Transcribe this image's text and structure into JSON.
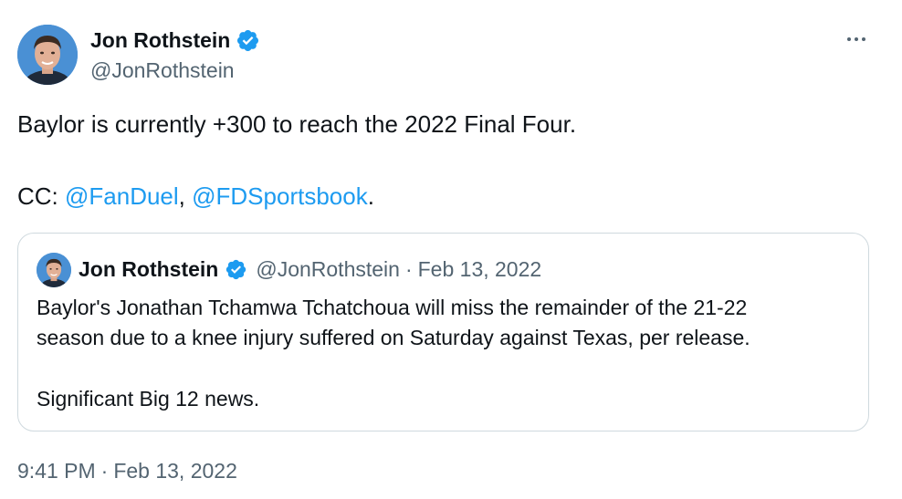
{
  "tweet": {
    "author": {
      "name": "Jon Rothstein",
      "handle": "@JonRothstein",
      "verified": true
    },
    "text_line1": "Baylor is currently +300 to reach the 2022 Final Four.",
    "cc_prefix": "CC: ",
    "mention1": "@FanDuel",
    "comma": ", ",
    "mention2": "@FDSportsbook",
    "period": ".",
    "time": "9:41 PM",
    "separator": "·",
    "date": "Feb 13, 2022"
  },
  "quote": {
    "name": "Jon Rothstein",
    "handle": "@JonRothstein",
    "separator": "·",
    "date": "Feb 13, 2022",
    "line1": "Baylor's Jonathan Tchamwa Tchatchoua will miss the remainder of the 21-22",
    "line2": "season due to a knee injury suffered on Saturday against Texas, per release.",
    "line3": "Significant Big 12 news."
  },
  "colors": {
    "link": "#1d9bf0",
    "secondary_text": "#536471",
    "verified_badge": "#1d9bf0",
    "border": "#cfd9de"
  },
  "icons": {
    "verified": "verified-badge-icon",
    "more": "more-horizontal-icon"
  }
}
